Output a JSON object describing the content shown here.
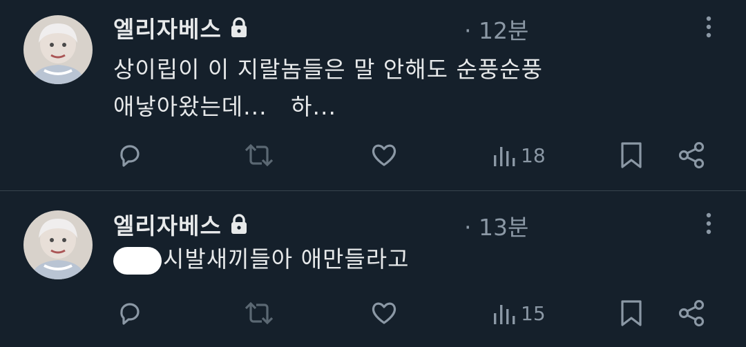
{
  "tweets": [
    {
      "author": "엘리자베스",
      "time": "· 12분",
      "lines": [
        "상이립이 이 지랄놈들은 말 안해도 순풍순풍",
        "애낳아왔는데...   하..."
      ],
      "views": "18"
    },
    {
      "author": "엘리자베스",
      "time": "· 13분",
      "redacted_prefix": true,
      "lines": [
        "시발새끼들아 애만들라고"
      ],
      "views": "15"
    }
  ],
  "icons": {
    "lock": "lock-icon",
    "more": "more-vertical-icon",
    "reply": "reply-icon",
    "retweet": "retweet-icon",
    "like": "heart-icon",
    "views": "views-icon",
    "bookmark": "bookmark-icon",
    "share": "share-icon"
  },
  "colors": {
    "background": "#15202b",
    "text": "#e7e9ea",
    "muted": "#8b98a5",
    "divider": "#38444d"
  }
}
